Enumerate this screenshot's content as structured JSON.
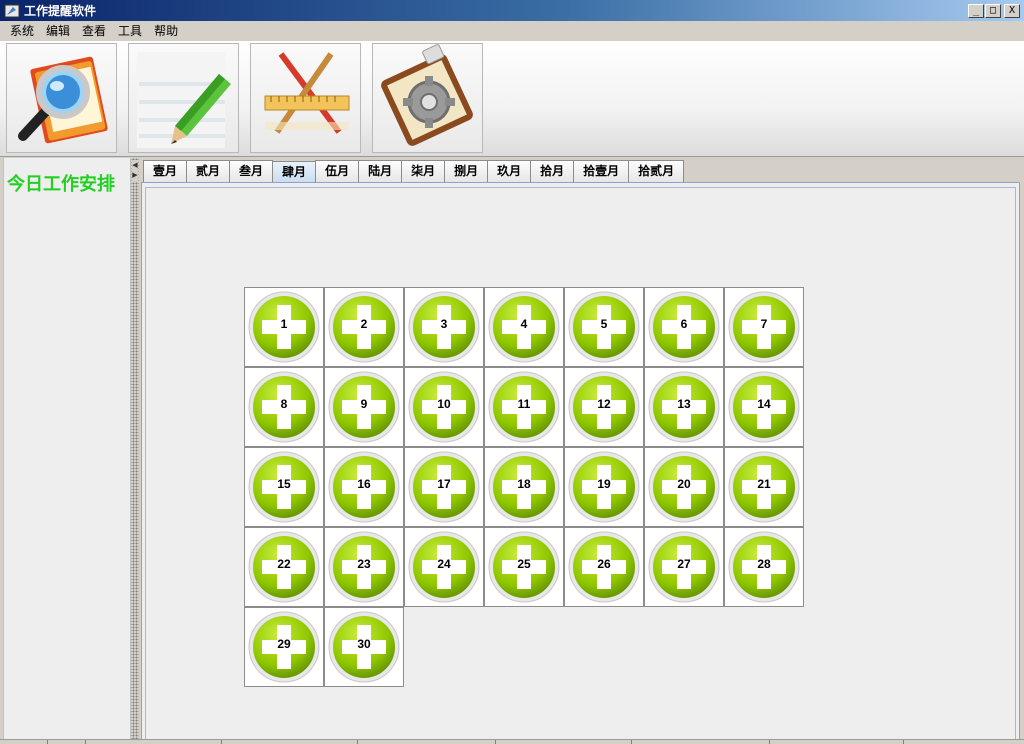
{
  "window": {
    "title": "工作提醒软件",
    "controls": {
      "minimize": "_",
      "maximize": "□",
      "close": "X"
    }
  },
  "menu": [
    "系统",
    "编辑",
    "查看",
    "工具",
    "帮助"
  ],
  "toolbar": [
    {
      "icon": "search-folder-icon"
    },
    {
      "icon": "edit-pencil-icon"
    },
    {
      "icon": "tools-ruler-pencil-icon"
    },
    {
      "icon": "settings-gear-clipboard-icon"
    }
  ],
  "left_panel": {
    "heading": "今日工作安排"
  },
  "tabs": [
    {
      "label": "壹月",
      "active": false
    },
    {
      "label": "贰月",
      "active": false
    },
    {
      "label": "叁月",
      "active": false
    },
    {
      "label": "肆月",
      "active": true
    },
    {
      "label": "伍月",
      "active": false
    },
    {
      "label": "陆月",
      "active": false
    },
    {
      "label": "柒月",
      "active": false
    },
    {
      "label": "捌月",
      "active": false
    },
    {
      "label": "玖月",
      "active": false
    },
    {
      "label": "拾月",
      "active": false
    },
    {
      "label": "拾壹月",
      "active": false
    },
    {
      "label": "拾贰月",
      "active": false
    }
  ],
  "days": [
    "1",
    "2",
    "3",
    "4",
    "5",
    "6",
    "7",
    "8",
    "9",
    "10",
    "11",
    "12",
    "13",
    "14",
    "15",
    "16",
    "17",
    "18",
    "19",
    "20",
    "21",
    "22",
    "23",
    "24",
    "25",
    "26",
    "27",
    "28",
    "29",
    "30"
  ],
  "colors": {
    "heading_green": "#22d022",
    "button_green": "#8fc700",
    "title_blue": "#0a246a"
  }
}
